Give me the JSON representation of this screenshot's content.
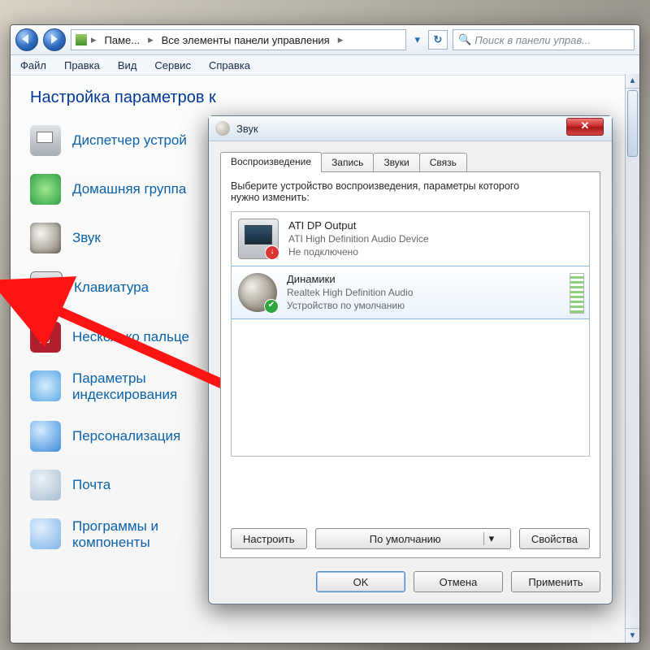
{
  "breadcrumbs": {
    "item1": "Паме...",
    "item2": "Все элементы панели управления"
  },
  "search": {
    "placeholder": "Поиск в панели управ..."
  },
  "menu": {
    "file": "Файл",
    "edit": "Правка",
    "view": "Вид",
    "tools": "Сервис",
    "help": "Справка"
  },
  "cp": {
    "heading": "Настройка параметров к",
    "items": {
      "devices": "Диспетчер устрой",
      "homegroup": "Домашняя группа",
      "sound": "Звук",
      "keyboard": "Клавиатура",
      "touch": "Несколько пальце",
      "indexing1": "Параметры",
      "indexing2": "индексирования",
      "personal": "Персонализация",
      "mail": "Почта",
      "programs1": "Программы и",
      "programs2": "компоненты",
      "default": "умолчанию"
    }
  },
  "sound": {
    "title": "Звук",
    "tabs": {
      "play": "Воспроизведение",
      "rec": "Запись",
      "sounds": "Звуки",
      "comm": "Связь"
    },
    "desc1": "Выберите устройство воспроизведения, параметры которого",
    "desc2": "нужно изменить:",
    "dev1": {
      "name": "ATI DP Output",
      "driver": "ATI High Definition Audio Device",
      "status": "Не подключено"
    },
    "dev2": {
      "name": "Динамики",
      "driver": "Realtek High Definition Audio",
      "status": "Устройство по умолчанию"
    },
    "configure": "Настроить",
    "default_btn": "По умолчанию",
    "properties": "Свойства",
    "ok": "OK",
    "cancel": "Отмена",
    "apply": "Применить"
  }
}
